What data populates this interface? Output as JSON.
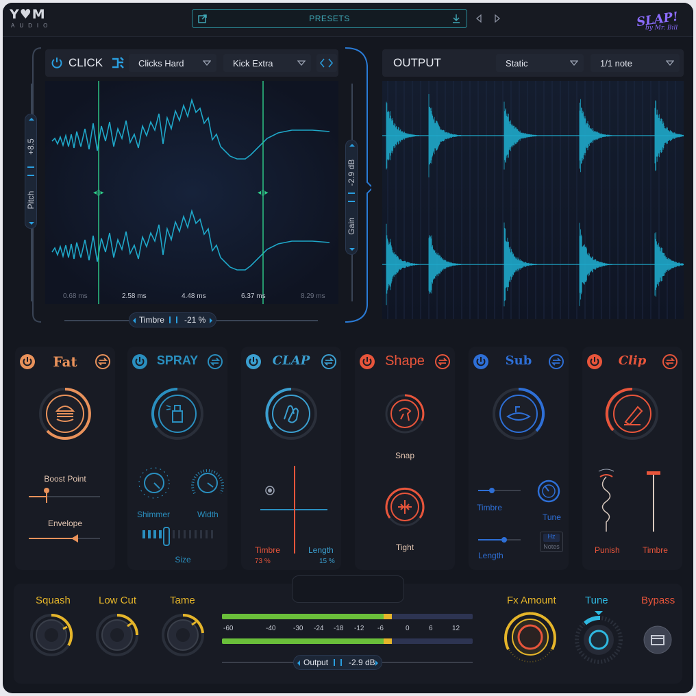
{
  "header": {
    "logo": "Y♥M",
    "logo_sub": "AUDIO",
    "presets_label": "PRESETS",
    "brand": "SLAP!",
    "brand_sub": "by Mr. Bill"
  },
  "click": {
    "title": "CLICK",
    "dropdown1": "Clicks Hard",
    "dropdown2": "Kick Extra",
    "pitch_value": "+8.5",
    "pitch_label": "Pitch",
    "gain_value": "-2.9 dB",
    "gain_label": "Gain",
    "time_ticks": [
      "0.68 ms",
      "2.58 ms",
      "4.48 ms",
      "6.37 ms",
      "8.29 ms"
    ],
    "timbre_label": "Timbre",
    "timbre_value": "-21 %"
  },
  "output": {
    "title": "OUTPUT",
    "mode": "Static",
    "note": "1/1 note"
  },
  "fx": [
    {
      "title": "Fat",
      "color": "#e9925b",
      "labels": {
        "a": "Boost Point",
        "b": "Envelope"
      }
    },
    {
      "title": "SPRAY",
      "color": "#2a8fbf",
      "labels": {
        "a": "Shimmer",
        "b": "Width",
        "c": "Size"
      }
    },
    {
      "title": "CLAP",
      "color": "#3b9fd0",
      "labels": {
        "a": "Timbre",
        "b": "Length",
        "va": "73  %",
        "vb": "15 %"
      }
    },
    {
      "title": "Shape",
      "color": "#e8553b",
      "labels": {
        "a": "Snap",
        "b": "Tight"
      }
    },
    {
      "title": "Sub",
      "color": "#2e6fd6",
      "labels": {
        "a": "Timbre",
        "b": "Tune",
        "c": "Length",
        "d": "Hz",
        "e": "Notes"
      }
    },
    {
      "title": "Clip",
      "color": "#e8553b",
      "labels": {
        "a": "Punish",
        "b": "Timbre"
      }
    }
  ],
  "bottom": {
    "squash": "Squash",
    "lowcut": "Low Cut",
    "tame": "Tame",
    "meter_ticks": [
      "-60",
      "-40",
      "-30",
      "-24",
      "-18",
      "-12",
      "-6",
      "0",
      "6",
      "12"
    ],
    "output_label": "Output",
    "output_value": "-2.9 dB",
    "fx_amount": "Fx Amount",
    "tune": "Tune",
    "bypass": "Bypass"
  },
  "colors": {
    "accent_teal": "#1fa8c9",
    "accent_orange": "#e8553b",
    "accent_yellow": "#e5b52a",
    "meter_green": "#6abf3a"
  }
}
